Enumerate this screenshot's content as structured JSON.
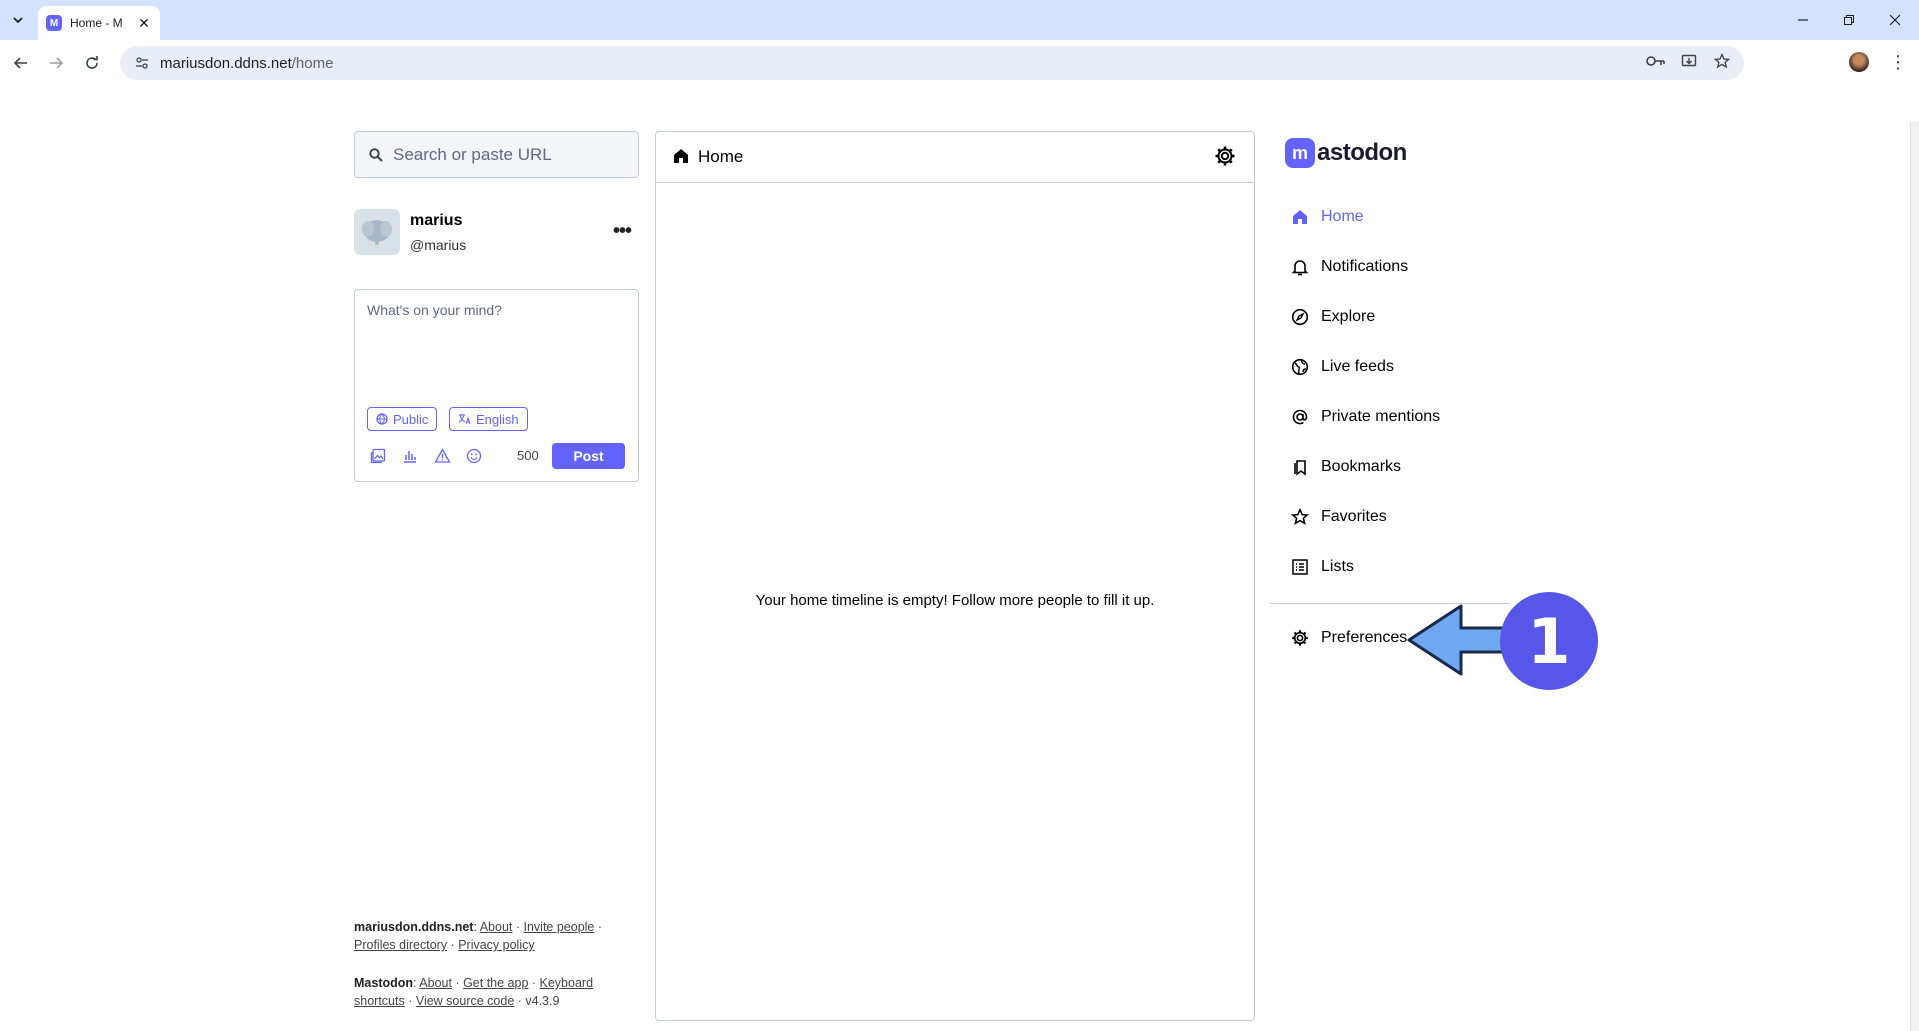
{
  "browser": {
    "tab_title": "Home - M",
    "tab_favicon": "M",
    "url_host": "mariusdon.ddns.net",
    "url_path": "/home"
  },
  "search": {
    "placeholder": "Search or paste URL"
  },
  "account": {
    "name": "marius",
    "handle": "@marius"
  },
  "compose": {
    "placeholder": "What's on your mind?",
    "visibility": "Public",
    "language": "English",
    "counter": "500",
    "post_label": "Post"
  },
  "column": {
    "title": "Home",
    "empty_message": "Your home timeline is empty! Follow more people to fill it up."
  },
  "logo": {
    "mark": "m",
    "word": "astodon"
  },
  "nav": {
    "home": "Home",
    "notifications": "Notifications",
    "explore": "Explore",
    "live_feeds": "Live feeds",
    "private_mentions": "Private mentions",
    "bookmarks": "Bookmarks",
    "favorites": "Favorites",
    "lists": "Lists",
    "preferences": "Preferences"
  },
  "annotation": {
    "step": "1"
  },
  "footer": {
    "server": "mariusdon.ddns.net",
    "about": "About",
    "invite": "Invite people",
    "profiles": "Profiles directory",
    "privacy": "Privacy policy",
    "mastodon": "Mastodon",
    "about2": "About",
    "get_app": "Get the app",
    "keyboard": "Keyboard shortcuts",
    "source": "View source code",
    "version": "v4.3.9"
  },
  "colors": {
    "accent": "#6364ff",
    "tabbar": "#d3e3fd",
    "annotation": "#5656e8",
    "arrow": "#6fa8f0"
  }
}
